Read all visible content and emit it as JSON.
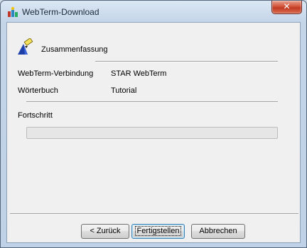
{
  "window": {
    "title": "WebTerm-Download",
    "close_symbol": "✕"
  },
  "header": {
    "title": "Zusammenfassung",
    "icon": "wizard-pen-icon"
  },
  "summary": {
    "rows": [
      {
        "label": "WebTerm-Verbindung",
        "value": "STAR WebTerm"
      },
      {
        "label": "Wörterbuch",
        "value": "Tutorial"
      }
    ]
  },
  "progress": {
    "label": "Fortschritt",
    "value": 0
  },
  "buttons": {
    "back": "< Zurück",
    "finish": "Fertigstellen",
    "cancel": "Abbrechen"
  },
  "colors": {
    "progress_fill": "#06b025",
    "close_button": "#c23b22"
  }
}
